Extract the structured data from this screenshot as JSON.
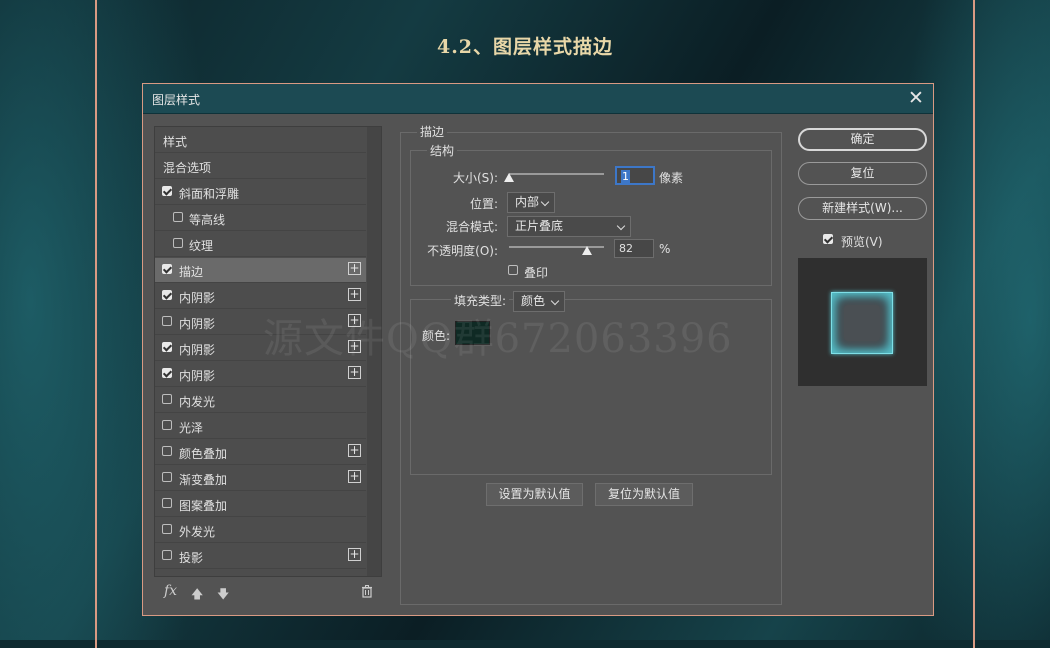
{
  "headline": "4.2、图层样式描边",
  "dialog": {
    "title": "图层样式",
    "close_icon": "close-icon"
  },
  "left_panel": {
    "items": [
      {
        "label": "样式",
        "checkbox": false,
        "checked": false,
        "plus": false,
        "selected": false
      },
      {
        "label": "混合选项",
        "checkbox": false,
        "checked": false,
        "plus": false,
        "selected": false
      },
      {
        "label": "斜面和浮雕",
        "checkbox": true,
        "checked": true,
        "plus": false,
        "selected": false
      },
      {
        "label": "等高线",
        "checkbox": true,
        "checked": false,
        "plus": false,
        "selected": false,
        "indent": true
      },
      {
        "label": "纹理",
        "checkbox": true,
        "checked": false,
        "plus": false,
        "selected": false,
        "indent": true
      },
      {
        "label": "描边",
        "checkbox": true,
        "checked": true,
        "plus": true,
        "selected": true
      },
      {
        "label": "内阴影",
        "checkbox": true,
        "checked": true,
        "plus": true,
        "selected": false
      },
      {
        "label": "内阴影",
        "checkbox": true,
        "checked": false,
        "plus": true,
        "selected": false
      },
      {
        "label": "内阴影",
        "checkbox": true,
        "checked": true,
        "plus": true,
        "selected": false
      },
      {
        "label": "内阴影",
        "checkbox": true,
        "checked": true,
        "plus": true,
        "selected": false
      },
      {
        "label": "内发光",
        "checkbox": true,
        "checked": false,
        "plus": false,
        "selected": false
      },
      {
        "label": "光泽",
        "checkbox": true,
        "checked": false,
        "plus": false,
        "selected": false
      },
      {
        "label": "颜色叠加",
        "checkbox": true,
        "checked": false,
        "plus": true,
        "selected": false
      },
      {
        "label": "渐变叠加",
        "checkbox": true,
        "checked": false,
        "plus": true,
        "selected": false
      },
      {
        "label": "图案叠加",
        "checkbox": true,
        "checked": false,
        "plus": false,
        "selected": false
      },
      {
        "label": "外发光",
        "checkbox": true,
        "checked": false,
        "plus": false,
        "selected": false
      },
      {
        "label": "投影",
        "checkbox": true,
        "checked": false,
        "plus": true,
        "selected": false
      }
    ],
    "bottom": {
      "fx": "fx",
      "up_icon": "arrow-up-icon",
      "down_icon": "arrow-down-icon",
      "trash_icon": "trash-icon"
    }
  },
  "stroke": {
    "group_title": "描边",
    "structure_title": "结构",
    "size_label": "大小(S):",
    "size_value": "1",
    "size_unit": "像素",
    "size_slider_fraction": 0.0,
    "position_label": "位置:",
    "position_value": "内部",
    "blend_label": "混合模式:",
    "blend_value": "正片叠底",
    "opacity_label": "不透明度(O):",
    "opacity_value": "82",
    "opacity_unit": "%",
    "opacity_slider_fraction": 0.82,
    "overprint_label": "叠印",
    "overprint_checked": false,
    "fill_type_label": "填充类型:",
    "fill_type_value": "颜色",
    "color_label": "颜色:",
    "color_swatch": "#0f2a24"
  },
  "buttons": {
    "set_default": "设置为默认值",
    "reset_default": "复位为默认值",
    "ok": "确定",
    "reset": "复位",
    "new_style": "新建样式(W)...",
    "preview_label": "预览(V)",
    "preview_checked": true
  },
  "watermark": "源文件QQ群672063396",
  "colors": {
    "accent_border": "#d99a83",
    "titlebar": "#1c4a53",
    "preview_glow": "#56c2cc"
  }
}
